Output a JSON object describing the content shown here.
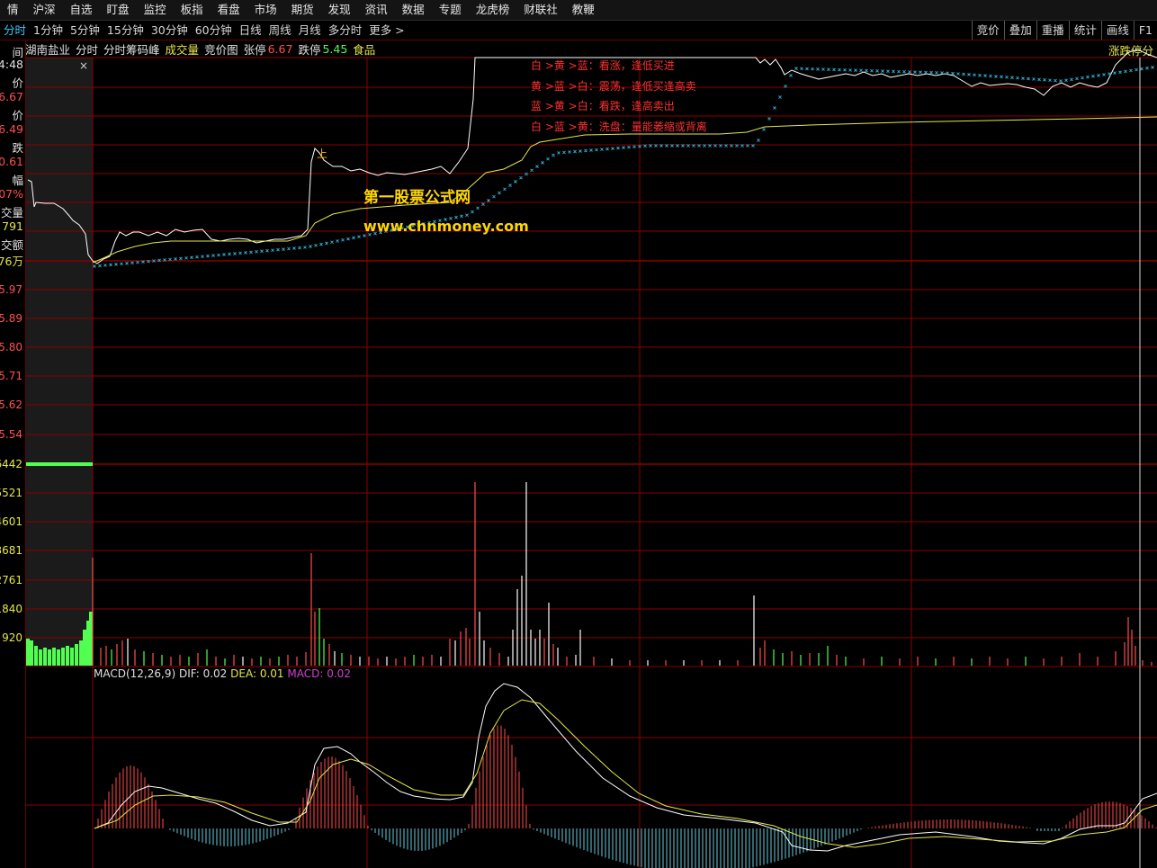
{
  "menubar": {
    "items": [
      "情",
      "沪深",
      "自选",
      "盯盘",
      "监控",
      "板指",
      "看盘",
      "市场",
      "期货",
      "发现",
      "资讯",
      "数据",
      "专题",
      "龙虎榜",
      "财联社",
      "教鞭"
    ]
  },
  "periodbar": {
    "items": [
      "分时",
      "1分钟",
      "5分钟",
      "15分钟",
      "30分钟",
      "60分钟",
      "日线",
      "周线",
      "月线",
      "多分时",
      "更多 >"
    ],
    "active": "分时"
  },
  "rightbuttons": [
    "竞价",
    "叠加",
    "重播",
    "统计",
    "画线",
    "F1"
  ],
  "infobar": {
    "stock": "湖南盐业",
    "tab1": "分时",
    "tab2": "分时筹码峰",
    "volume_label": "成交量",
    "auction_label": "竞价图",
    "limit_up_label": "张停",
    "limit_up_value": "6.67",
    "limit_down_label": "跌停",
    "limit_down_value": "5.45",
    "sector": "食品"
  },
  "top_right_label": "涨跌停分",
  "left_quote": {
    "time_label": "间",
    "time": "4:48",
    "price_label": "价",
    "price": "6.67",
    "avg_label": "价",
    "avg": "6.49",
    "change_label": "跌",
    "change": "0.61",
    "pct_label": "幅",
    "pct": "07%",
    "vol_label": "交量",
    "vol": "791",
    "amt_label": "交额",
    "amt": "76万"
  },
  "price_axis": [
    "5.97",
    "5.89",
    "5.80",
    "5.71",
    "5.62",
    "5.54"
  ],
  "volume_axis": [
    "6442",
    "5521",
    "4601",
    "3681",
    "2761",
    "1840",
    "920"
  ],
  "watermark": {
    "line1": "第一股票公式网",
    "line2": "www.chnmoney.com"
  },
  "notes": [
    "白 >黄 >蓝：看涨，逢低买进",
    "黄 >蓝 >白：震荡，逢低买逢高卖",
    "蓝 >黄 >白：看跌，逢高卖出",
    "白 >蓝 >黄：洗盘：量能萎缩或背离"
  ],
  "macd": {
    "label": "MACD(12,26,9)",
    "dif_label": "DIF:",
    "dif": "0.02",
    "dea_label": "DEA:",
    "dea": "0.01",
    "macd_label": "MACD:",
    "macd": "0.02"
  },
  "icons": {
    "close": "close-icon",
    "marker": "shang-marker-icon"
  },
  "marker_text": "上",
  "colors": {
    "price_line": "#ffffff",
    "avg_line": "#e6e64a",
    "dots": "#33aacc",
    "grid": "#8a0000",
    "up": "#ff4d4d",
    "down": "#50ff50",
    "macd_neg": "#66ccdd"
  }
}
